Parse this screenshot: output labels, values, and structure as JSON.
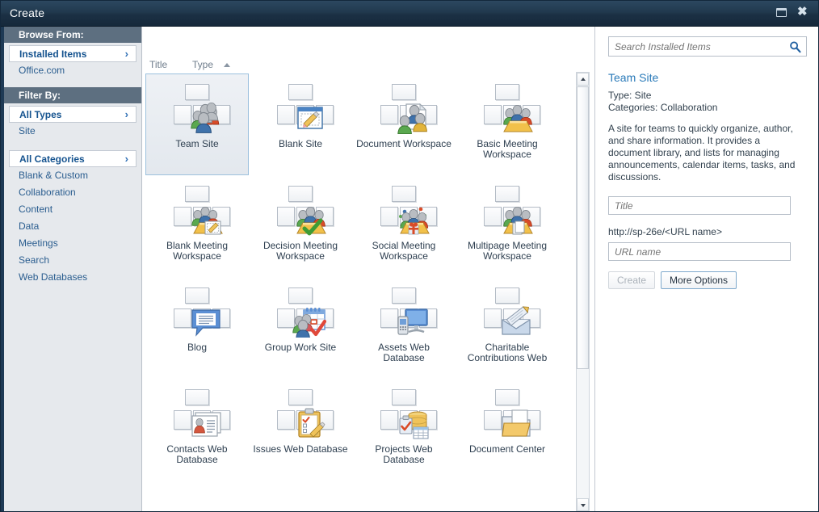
{
  "window": {
    "title": "Create",
    "restore_icon": "restore-icon",
    "close_icon": "close-icon"
  },
  "sidebar": {
    "browse_from_header": "Browse From:",
    "browse_items": [
      {
        "label": "Installed Items",
        "selected": true
      },
      {
        "label": "Office.com",
        "selected": false
      }
    ],
    "filter_by_header": "Filter By:",
    "type_items": [
      {
        "label": "All Types",
        "selected": true
      },
      {
        "label": "Site",
        "selected": false
      }
    ],
    "category_items": [
      {
        "label": "All Categories",
        "selected": true
      },
      {
        "label": "Blank & Custom",
        "selected": false
      },
      {
        "label": "Collaboration",
        "selected": false
      },
      {
        "label": "Content",
        "selected": false
      },
      {
        "label": "Data",
        "selected": false
      },
      {
        "label": "Meetings",
        "selected": false
      },
      {
        "label": "Search",
        "selected": false
      },
      {
        "label": "Web Databases",
        "selected": false
      }
    ],
    "chevron_icon": "chevron-right-icon"
  },
  "gallery": {
    "columns": {
      "title": "Title",
      "type": "Type"
    },
    "sort_indicator": "sort-ascending-icon",
    "tiles": [
      {
        "label": "Team Site",
        "icon": "people-group-icon",
        "selected": true
      },
      {
        "label": "Blank Site",
        "icon": "pencil-page-icon",
        "selected": false
      },
      {
        "label": "Document Workspace",
        "icon": "document-people-icon",
        "selected": false
      },
      {
        "label": "Basic Meeting Workspace",
        "icon": "meeting-table-icon",
        "selected": false
      },
      {
        "label": "Blank Meeting Workspace",
        "icon": "meeting-pencil-icon",
        "selected": false
      },
      {
        "label": "Decision Meeting Workspace",
        "icon": "meeting-check-icon",
        "selected": false
      },
      {
        "label": "Social Meeting Workspace",
        "icon": "meeting-gift-icon",
        "selected": false
      },
      {
        "label": "Multipage Meeting Workspace",
        "icon": "meeting-pages-icon",
        "selected": false
      },
      {
        "label": "Blog",
        "icon": "speech-bubble-icon",
        "selected": false
      },
      {
        "label": "Group Work Site",
        "icon": "calendar-people-icon",
        "selected": false
      },
      {
        "label": "Assets Web Database",
        "icon": "monitor-phone-icon",
        "selected": false
      },
      {
        "label": "Charitable Contributions Web",
        "icon": "envelope-pencil-icon",
        "selected": false
      },
      {
        "label": "Contacts Web Database",
        "icon": "contact-card-icon",
        "selected": false
      },
      {
        "label": "Issues Web Database",
        "icon": "clipboard-pencil-icon",
        "selected": false
      },
      {
        "label": "Projects Web Database",
        "icon": "database-clipboard-icon",
        "selected": false
      },
      {
        "label": "Document Center",
        "icon": "folder-document-icon",
        "selected": false
      }
    ]
  },
  "search": {
    "placeholder": "Search Installed Items",
    "value": "",
    "icon": "search-icon"
  },
  "details": {
    "title": "Team Site",
    "type_line": "Type: Site",
    "categories_line": "Categories: Collaboration",
    "description": "A site for teams to quickly organize, author, and share information. It provides a document library, and lists for managing announcements, calendar items, tasks, and discussions.",
    "title_field": {
      "placeholder": "Title",
      "value": ""
    },
    "url_prefix": "http://sp-26e/<URL name>",
    "url_field": {
      "placeholder": "URL name",
      "value": ""
    },
    "create_button": "Create",
    "more_options_button": "More Options"
  },
  "scrollbar": {
    "up_icon": "scroll-up-arrow-icon",
    "down_icon": "scroll-down-arrow-icon"
  },
  "colors": {
    "titlebar": "#21394e",
    "sidebar_bg": "#e6e9ed",
    "sidebar_header": "#5d6f80",
    "accent_link": "#2a5d8f",
    "detail_title": "#2a7ab9",
    "selected_tile_border": "#9cc0dd"
  }
}
